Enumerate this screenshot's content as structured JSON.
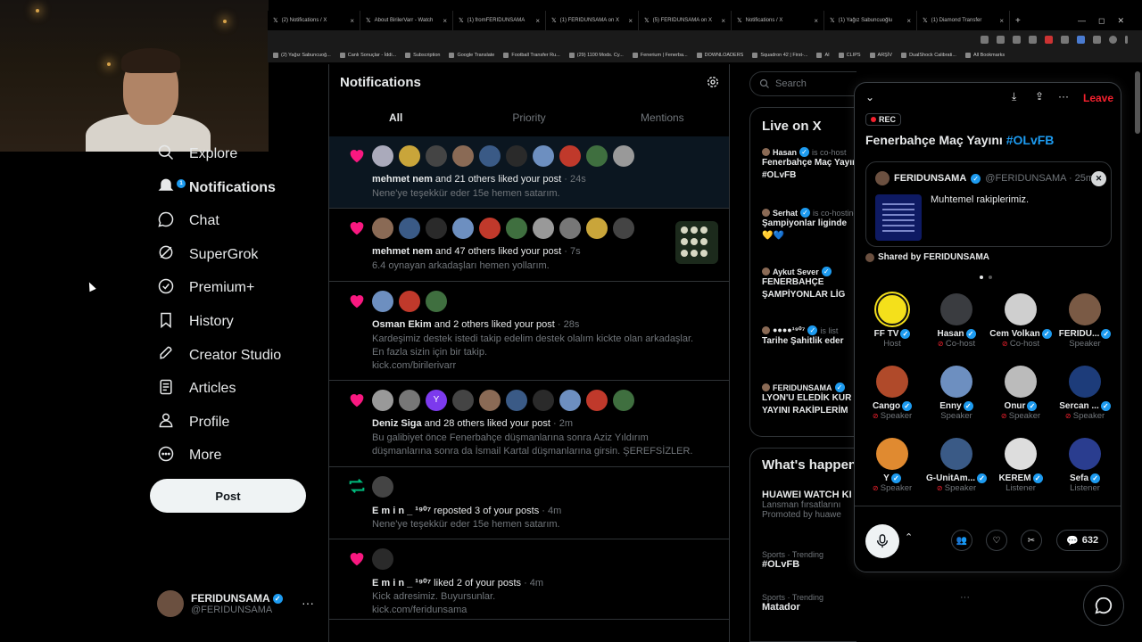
{
  "browser": {
    "tabs": [
      "(2) Notifications / X",
      "About BirilerVarr - Watch",
      "(1) fromFERIDUNSAMA",
      "(1) FERIDUNSAMA on X",
      "(5) FERIDUNSAMA on X",
      "Notifications / X",
      "(1) Yağız Sabuncuoğlu",
      "(1) Diamond Transfer"
    ],
    "new_tab": "+",
    "bookmarks": [
      "(2) Yağız Sabuncuoğ...",
      "Canlı Sonuçlar - İddi...",
      "Subscription",
      "Google Translate",
      "Football Transfer Ru...",
      "(29) 1100 Mods. Cy...",
      "Fenerium | Fenerba...",
      "DOWNLOADERS",
      "Squadron 42 | First-...",
      "AI",
      "CLIPS",
      "ARŞİV",
      "DualShock Calibrati...",
      "All Bookmarks"
    ]
  },
  "nav": {
    "items": [
      {
        "label": "Explore",
        "icon": "search-icon"
      },
      {
        "label": "Notifications",
        "icon": "bell-icon",
        "badge": "1"
      },
      {
        "label": "Chat",
        "icon": "chat-icon"
      },
      {
        "label": "SuperGrok",
        "icon": "grok-icon"
      },
      {
        "label": "Premium+",
        "icon": "premium-icon"
      },
      {
        "label": "History",
        "icon": "bookmark-icon"
      },
      {
        "label": "Creator Studio",
        "icon": "rocket-icon"
      },
      {
        "label": "Articles",
        "icon": "article-icon"
      },
      {
        "label": "Profile",
        "icon": "person-icon"
      },
      {
        "label": "More",
        "icon": "more-circle-icon"
      }
    ],
    "post_label": "Post",
    "account": {
      "name": "FERIDUNSAMA",
      "handle": "@FERIDUNSAMA",
      "more": "···"
    }
  },
  "main": {
    "title": "Notifications",
    "tabs": [
      "All",
      "Priority",
      "Mentions"
    ],
    "notifications": [
      {
        "type": "like",
        "user": "mehmet nem",
        "rest": " and 21 others liked your post",
        "time": "24s",
        "text": [
          "Nene'ye teşekkür eder 15e hemen satarım."
        ]
      },
      {
        "type": "like",
        "user": "mehmet nem",
        "rest": " and 47 others liked your post",
        "time": "7s",
        "text": [
          "6.4 oynayan arkadaşları hemen yollarım."
        ]
      },
      {
        "type": "like",
        "user": "Osman Ekim",
        "rest": " and 2 others liked your post",
        "time": "28s",
        "text": [
          "Kardeşimiz destek istedi takip edelim destek olalım kickte olan arkadaşlar.",
          "En fazla sizin için bir takip.",
          "kick.com/birilerivarr"
        ]
      },
      {
        "type": "like",
        "user": "Deniz Siga",
        "rest": " and 28 others liked your post",
        "time": "2m",
        "text": [
          "Bu galibiyet önce Fenerbahçe düşmanlarına sonra Aziz Yıldırım",
          "düşmanlarına sonra da İsmail Kartal düşmanlarına girsin. ŞEREFSİZLER."
        ]
      },
      {
        "type": "repost",
        "user": "E m i n _ ¹⁹⁰⁷",
        "rest": " reposted 3 of your posts",
        "time": "4m",
        "text": [
          "Nene'ye teşekkür eder 15e hemen satarım."
        ]
      },
      {
        "type": "like",
        "user": "E m i n _ ¹⁹⁰⁷",
        "rest": " liked 2 of your posts",
        "time": "4m",
        "text": [
          "Kick adresimiz. Buyursunlar.",
          "kick.com/feridunsama"
        ]
      }
    ],
    "letter_avatar": "Y"
  },
  "right": {
    "search_placeholder": "Search",
    "live_title": "Live on X",
    "live": [
      {
        "who": "Hasan",
        "role": "is co-host",
        "title": [
          "Fenerbahçe Maç Yayını",
          "#OLvFB"
        ]
      },
      {
        "who": "Serhat",
        "role": "is co-hosting",
        "title": [
          "Şampiyonlar liginde",
          "💛💙"
        ]
      },
      {
        "who": "Aykut Sever",
        "role": "",
        "title": [
          "FENERBAHÇE",
          "ŞAMPİYONLAR LİG"
        ]
      },
      {
        "who": "●●●●¹⁹⁰⁷",
        "role": "is list",
        "title": [
          "Tarihe Şahitlik eder"
        ]
      },
      {
        "who": "FERIDUNSAMA",
        "role": "",
        "title": [
          "LYON'U ELEDİK KUR",
          "YAYINI RAKİPLERİM"
        ]
      }
    ],
    "happening_title": "What's happening",
    "trends": [
      {
        "ctx": "",
        "title": "HUAWEI WATCH KI",
        "desc": "Lansman fırsatlarını",
        "promo": "Promoted by huawe"
      },
      {
        "ctx": "Sports · Trending",
        "title": "#OLvFB",
        "desc": "",
        "promo": ""
      },
      {
        "ctx": "Sports · Trending",
        "title": "Matador",
        "desc": "",
        "promo": ""
      }
    ],
    "trend_more": "···"
  },
  "space": {
    "leave": "Leave",
    "rec": "REC",
    "title": "Fenerbahçe Maç Yayını ",
    "title_tag": "#OLvFB",
    "card": {
      "name": "FERIDUNSAMA",
      "handle": "@FERIDUNSAMA · 25m",
      "text": "Muhtemel rakiplerimiz.",
      "close": "✕"
    },
    "shared_by": "Shared by FERIDUNSAMA",
    "users": [
      {
        "name": "FF TV",
        "role": "Host",
        "color": "#f4e01b",
        "muted": false
      },
      {
        "name": "Hasan",
        "role": "Co-host",
        "color": "#3a3c40",
        "muted": true
      },
      {
        "name": "Cem Volkan",
        "role": "Co-host",
        "color": "#cfcfcf",
        "muted": true
      },
      {
        "name": "FERIDU...",
        "role": "Speaker",
        "color": "#7a5a45",
        "muted": false
      },
      {
        "name": "Cango",
        "role": "Speaker",
        "color": "#b04a2a",
        "muted": true
      },
      {
        "name": "Enny",
        "role": "Speaker",
        "color": "#6d8fc0",
        "muted": false
      },
      {
        "name": "Onur",
        "role": "Speaker",
        "color": "#bbbbbb",
        "muted": true
      },
      {
        "name": "Sercan ...",
        "role": "Speaker",
        "color": "#1d3c7a",
        "muted": true
      },
      {
        "name": "Y",
        "role": "Speaker",
        "color": "#e08a30",
        "muted": true
      },
      {
        "name": "G-UnitAm...",
        "role": "Speaker",
        "color": "#3a5a86",
        "muted": true
      },
      {
        "name": "KEREM",
        "role": "Listener",
        "color": "#dddddd",
        "muted": false
      },
      {
        "name": "Sefa",
        "role": "Listener",
        "color": "#2a3d8f",
        "muted": false
      }
    ],
    "reply_count": "632"
  }
}
